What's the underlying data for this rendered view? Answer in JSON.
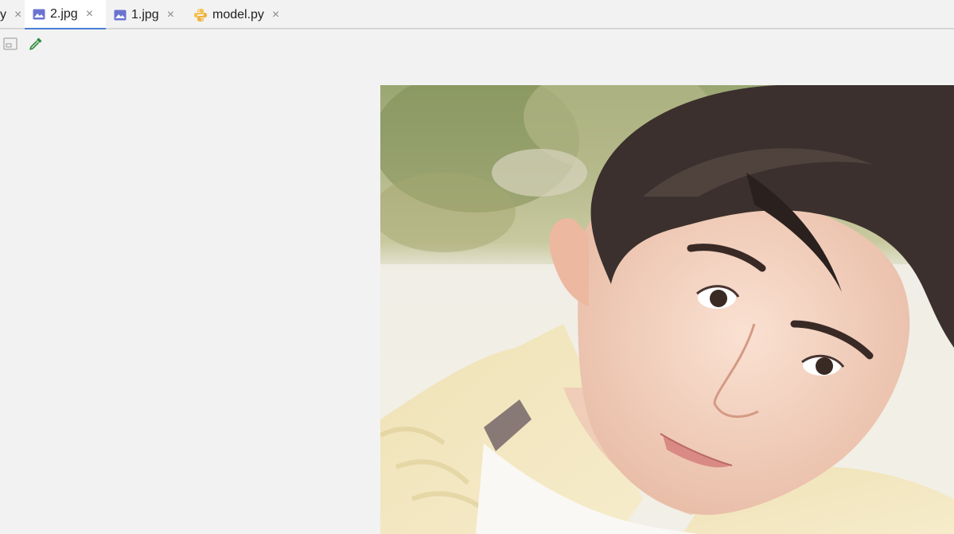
{
  "tabs": [
    {
      "label": "y",
      "type": "python",
      "active": false,
      "partial": true
    },
    {
      "label": "2.jpg",
      "type": "image",
      "active": true
    },
    {
      "label": "1.jpg",
      "type": "image",
      "active": false
    },
    {
      "label": "model.py",
      "type": "python",
      "active": false
    }
  ],
  "close_glyph": "×",
  "toolbar": {
    "fit_icon": "image-frame-icon",
    "picker_icon": "eyedropper-icon",
    "picker_color": "#2e8b3d"
  },
  "colors": {
    "accent": "#4a7fd6",
    "image_icon": "#6a73d0"
  }
}
